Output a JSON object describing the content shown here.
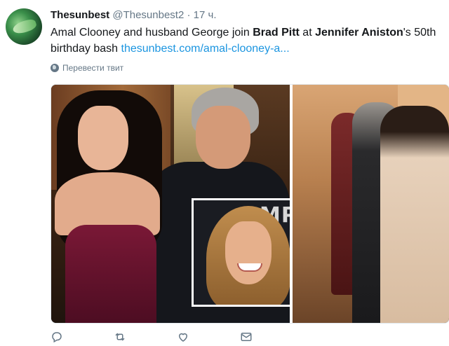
{
  "author": {
    "name": "Thesunbest",
    "handle": "@Thesunbest2",
    "separator": "·",
    "time": "17 ч."
  },
  "tweet": {
    "text_1": "Amal Clooney and husband George join ",
    "bold_1": "Brad Pitt",
    "text_2": " at ",
    "bold_2": "Jennifer Aniston",
    "text_3": "'s 50th birthday bash ",
    "link": "thesunbest.com/amal-clooney-a..."
  },
  "translate_label": "Перевести твит",
  "media": {
    "inset_backdrop_text": "MPI"
  },
  "actions": [
    {
      "icon": "reply-icon"
    },
    {
      "icon": "retweet-icon"
    },
    {
      "icon": "like-icon"
    },
    {
      "icon": "dm-icon"
    }
  ],
  "colors": {
    "link": "#1b95e0",
    "secondary": "#657786",
    "text": "#14171a"
  }
}
